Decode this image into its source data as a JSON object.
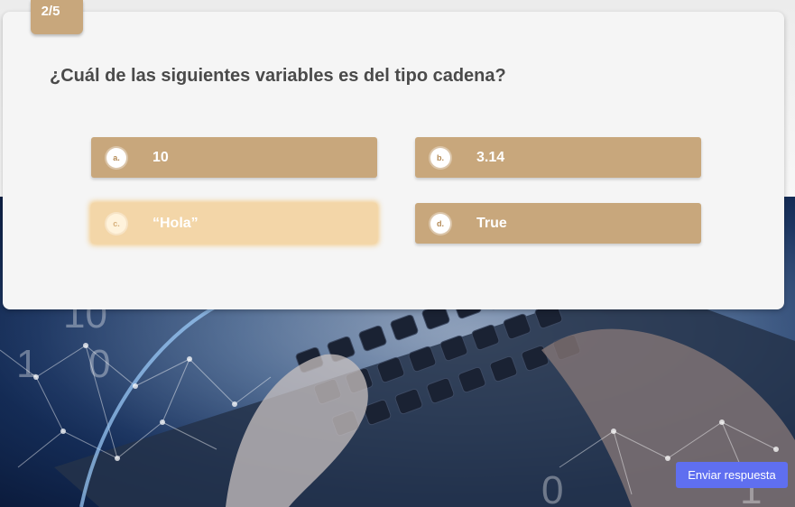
{
  "progress": {
    "label": "2/5"
  },
  "question": {
    "text": "¿Cuál de las siguientes variables es del tipo cadena?"
  },
  "options": [
    {
      "letter": "a.",
      "text": "10",
      "selected": false
    },
    {
      "letter": "b.",
      "text": "3.14",
      "selected": false
    },
    {
      "letter": "c.",
      "text": "“Hola”",
      "selected": true
    },
    {
      "letter": "d.",
      "text": "True",
      "selected": false
    }
  ],
  "submit": {
    "label": "Enviar respuesta"
  },
  "colors": {
    "option_bg": "#c8a77c",
    "option_selected_bg": "#f3d6a8",
    "submit_bg": "#5f6ff0",
    "card_bg": "#f5f5f5"
  },
  "background": {
    "image": "hands-typing-on-laptop-keyboard-with-network-overlay"
  }
}
